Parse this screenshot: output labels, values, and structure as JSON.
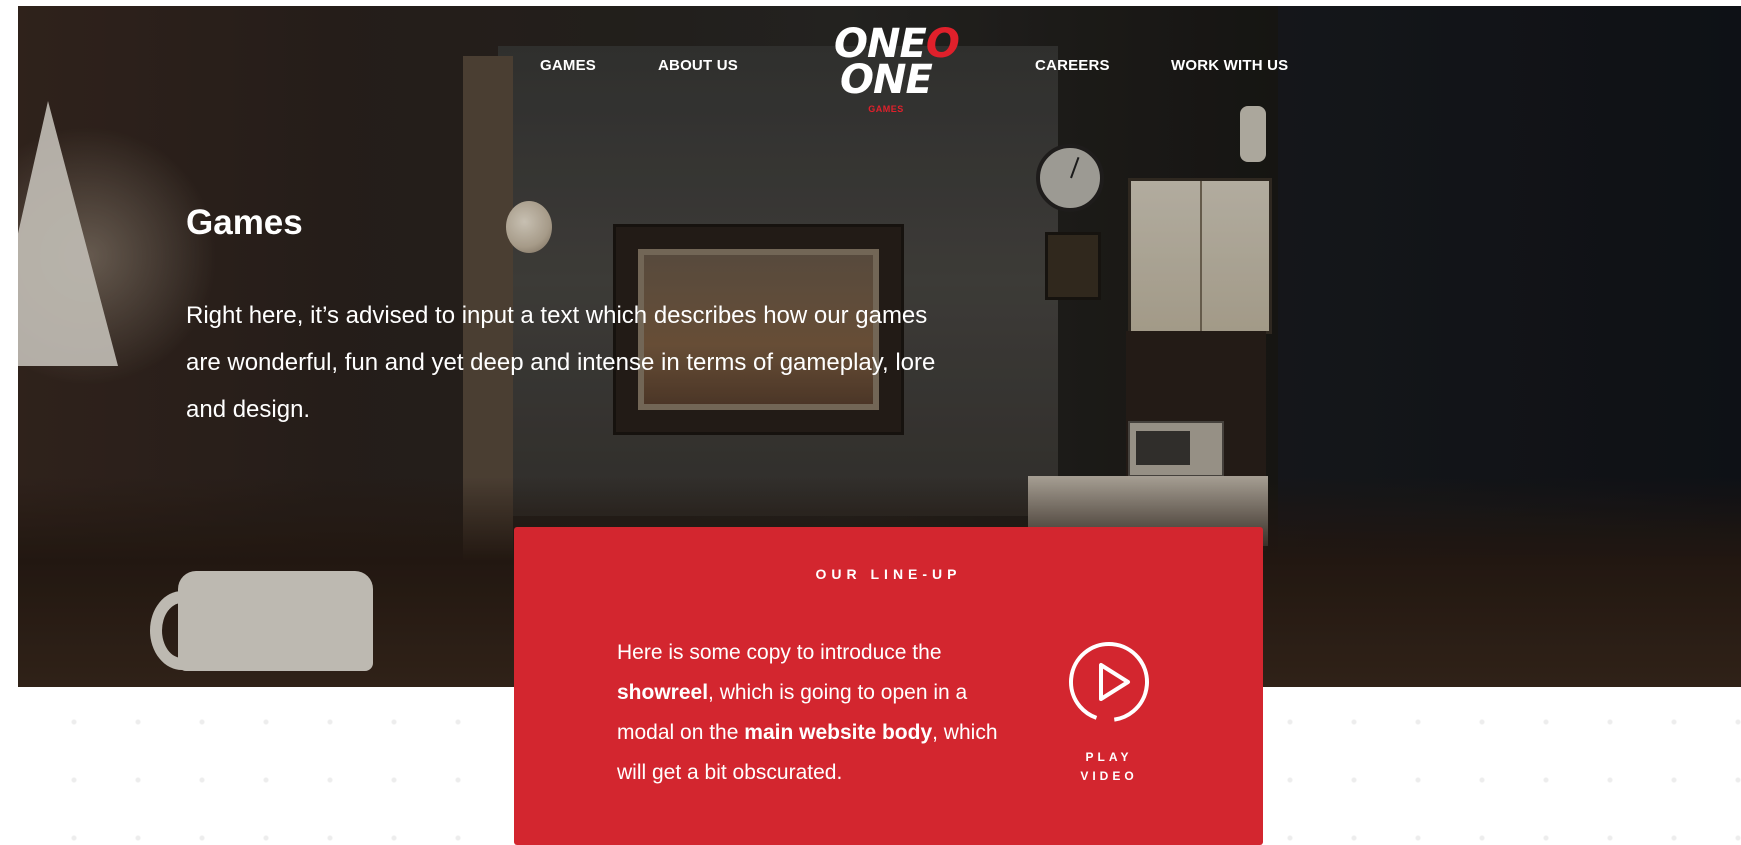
{
  "nav": {
    "left_items": [
      "GAMES",
      "ABOUT US"
    ],
    "right_items": [
      "CAREERS",
      "WORK WITH US"
    ]
  },
  "logo": {
    "line1_white": "ONE",
    "line1_red": "O",
    "line2_white": "ONE",
    "subtitle": "GAMES"
  },
  "hero": {
    "title": "Games",
    "description": "Right here, it’s advised to input a text which describes how our games are wonderful, fun and yet deep and intense in terms of gameplay, lore and design."
  },
  "lineup": {
    "heading": "OUR LINE-UP",
    "text_part1": "Here is some copy to introduce the ",
    "text_bold1": "showreel",
    "text_part2": ", which is going to open in a modal on the ",
    "text_bold2": "main website body",
    "text_part3": ", which will get a bit obscurated.",
    "play_label_line1": "PLAY",
    "play_label_line2": "VIDEO",
    "play_icon": "play-circle-icon"
  },
  "colors": {
    "accent_red": "#d3262f",
    "logo_red": "#e0202b",
    "white": "#ffffff"
  }
}
